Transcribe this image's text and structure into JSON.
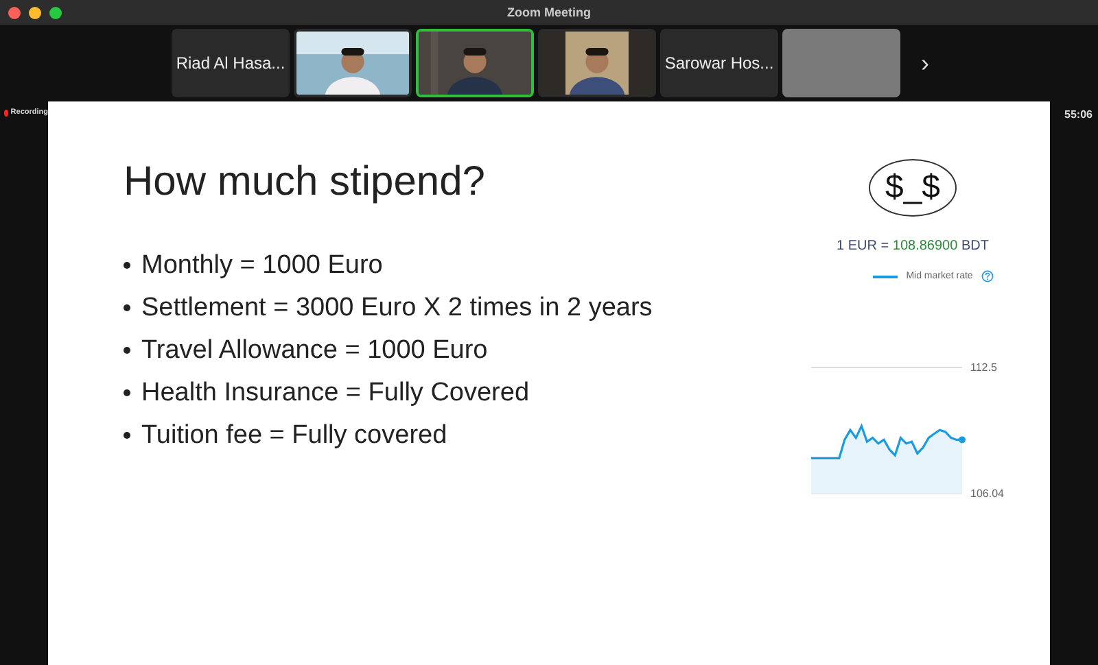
{
  "window": {
    "title": "Zoom Meeting"
  },
  "participants": [
    {
      "kind": "name",
      "name": "Riad Al Hasa...",
      "active": false
    },
    {
      "kind": "video",
      "active": false
    },
    {
      "kind": "video",
      "active": true
    },
    {
      "kind": "video",
      "active": false
    },
    {
      "kind": "name",
      "name": "Sarowar Hos...",
      "active": false
    },
    {
      "kind": "blank",
      "active": false
    }
  ],
  "next_arrow": "›",
  "recording": "Recording",
  "timer": "55:06",
  "slide": {
    "title": "How much stipend?",
    "bullets": [
      "Monthly  = 1000 Euro",
      "Settlement = 3000 Euro X 2 times in 2 years",
      "Travel Allowance = 1000 Euro",
      "Health Insurance = Fully Covered",
      "Tuition fee = Fully covered"
    ],
    "logo": "$_$",
    "rate": {
      "base": "1 EUR =",
      "value": "108.86900",
      "quote": "BDT"
    },
    "chart_data": {
      "type": "area",
      "series": [
        {
          "name": "Mid market rate",
          "color": "#1a9be0",
          "values": [
            107.85,
            107.85,
            107.85,
            107.85,
            107.85,
            107.85,
            108.8,
            109.3,
            108.9,
            109.5,
            108.7,
            108.9,
            108.6,
            108.8,
            108.3,
            108.0,
            108.9,
            108.6,
            108.7,
            108.1,
            108.4,
            108.9,
            109.1,
            109.3,
            109.2,
            108.9,
            108.8,
            108.8
          ]
        }
      ],
      "ylim": [
        106.04,
        112.5
      ],
      "yticks": [
        106.04,
        112.5
      ]
    }
  }
}
